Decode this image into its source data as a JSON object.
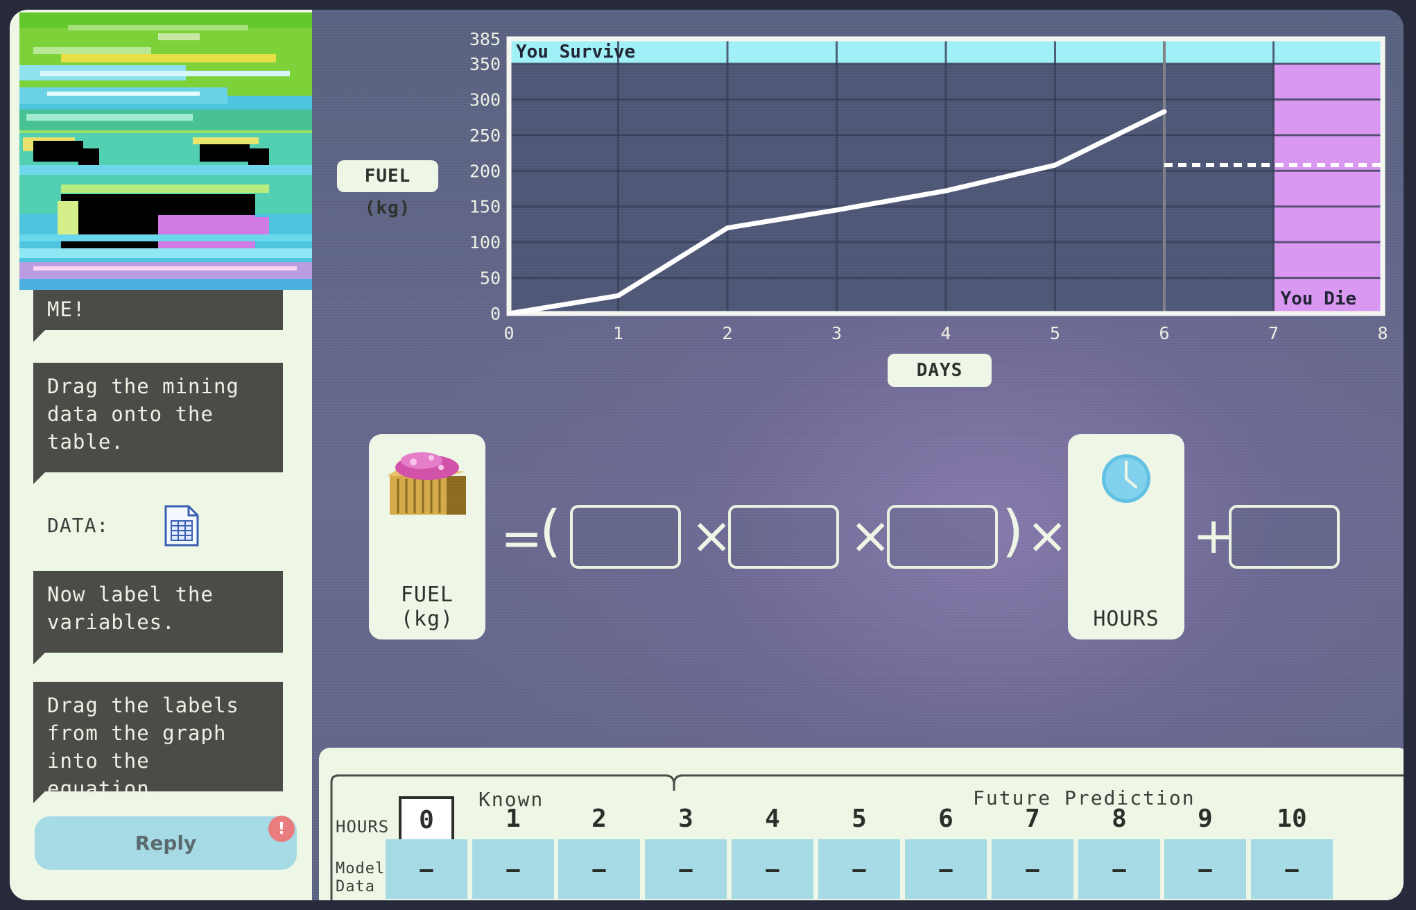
{
  "chat": {
    "messages": [
      "ME!",
      "Drag the mining data onto the table.",
      "Now label the variables.",
      "Drag the labels from the graph into the equation."
    ],
    "data_label": "DATA:",
    "reply_label": "Reply",
    "reply_badge": "!"
  },
  "chart_data": {
    "type": "line",
    "xlabel": "DAYS",
    "ylabel": "FUEL (kg)",
    "x_ticks": [
      "0",
      "1",
      "2",
      "3",
      "4",
      "5",
      "6",
      "7",
      "8"
    ],
    "y_ticks": [
      "0",
      "50",
      "100",
      "150",
      "200",
      "250",
      "300",
      "350",
      "385"
    ],
    "xlim": [
      0,
      8
    ],
    "ylim": [
      0,
      385
    ],
    "series": [
      {
        "x": [
          0,
          1,
          2,
          3,
          4,
          5,
          6
        ],
        "y": [
          0,
          25,
          120,
          145,
          172,
          208,
          283
        ]
      }
    ],
    "threshold": {
      "y": 208,
      "x_from": 6,
      "x_to": 8,
      "style": "dotted"
    },
    "survive_zone": {
      "label": "You Survive",
      "y_from": 350,
      "y_to": 385,
      "color": "#9ff0f7"
    },
    "die_zone": {
      "label": "You Die",
      "x_from": 7,
      "x_to": 8,
      "color": "#d996f1"
    },
    "grid": true,
    "current_day_marker": 6
  },
  "equation": {
    "fuel_label": "FUEL (kg)",
    "hours_label": "HOURS",
    "equals": "=",
    "open_paren": "(",
    "close_paren": ")",
    "times": "×",
    "plus": "+"
  },
  "table": {
    "known_label": "Known",
    "future_label": "Future Prediction",
    "hours_label": "HOURS",
    "modeled_label": "Modeled Data",
    "hours": [
      "0",
      "1",
      "2",
      "3",
      "4",
      "5",
      "6",
      "7",
      "8",
      "9",
      "10"
    ],
    "modeled": [
      "–",
      "–",
      "–",
      "–",
      "–",
      "–",
      "–",
      "–",
      "–",
      "–",
      "–"
    ],
    "selected_hour": "0"
  },
  "colors": {
    "panel": "#eef6e6",
    "bubble": "#4b4c48",
    "cell": "#a6dbe6",
    "survive": "#9ff0f7",
    "die": "#d996f1",
    "alert": "#e97c7e"
  }
}
